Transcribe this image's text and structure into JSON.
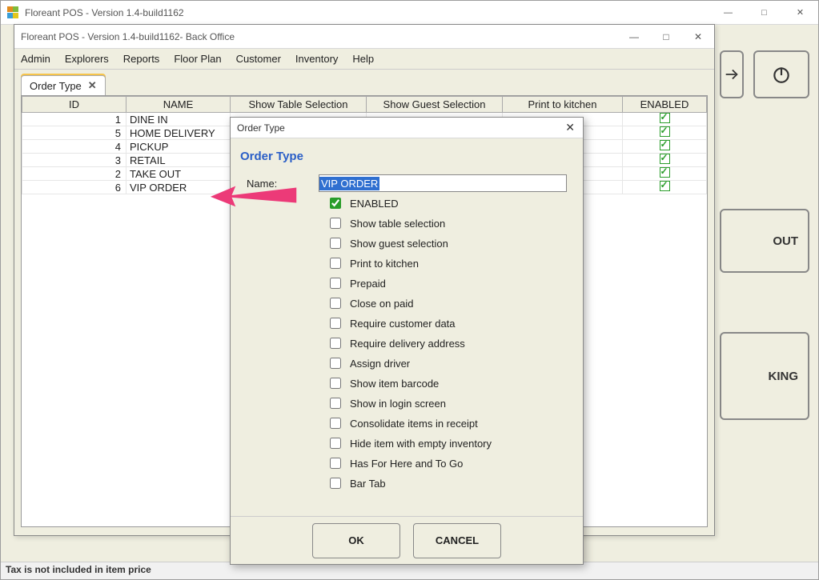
{
  "main": {
    "title": "Floreant POS - Version 1.4-build1162",
    "statusbar": "Tax is not included in item price",
    "side_buttons": {
      "out": "OUT",
      "king": "KING"
    }
  },
  "back_office": {
    "title": "Floreant POS - Version 1.4-build1162- Back Office",
    "menu": [
      "Admin",
      "Explorers",
      "Reports",
      "Floor Plan",
      "Customer",
      "Inventory",
      "Help"
    ],
    "tab": {
      "label": "Order Type"
    },
    "table": {
      "columns": [
        "ID",
        "NAME",
        "Show Table Selection",
        "Show Guest Selection",
        "Print to kitchen",
        "ENABLED"
      ],
      "rows": [
        {
          "id": "1",
          "name": "DINE IN",
          "enabled": true
        },
        {
          "id": "5",
          "name": "HOME DELIVERY",
          "enabled": true
        },
        {
          "id": "4",
          "name": "PICKUP",
          "enabled": true
        },
        {
          "id": "3",
          "name": "RETAIL",
          "enabled": true
        },
        {
          "id": "2",
          "name": "TAKE OUT",
          "enabled": true
        },
        {
          "id": "6",
          "name": "VIP ORDER",
          "enabled": true
        }
      ]
    }
  },
  "dialog": {
    "title": "Order Type",
    "header": "Order Type",
    "name_label": "Name:",
    "name_value": "VIP ORDER",
    "options": [
      {
        "label": "ENABLED",
        "checked": true
      },
      {
        "label": "Show table selection",
        "checked": false
      },
      {
        "label": "Show guest selection",
        "checked": false
      },
      {
        "label": "Print to kitchen",
        "checked": false
      },
      {
        "label": "Prepaid",
        "checked": false
      },
      {
        "label": "Close on paid",
        "checked": false
      },
      {
        "label": "Require customer data",
        "checked": false
      },
      {
        "label": "Require delivery address",
        "checked": false
      },
      {
        "label": "Assign driver",
        "checked": false
      },
      {
        "label": "Show item barcode",
        "checked": false
      },
      {
        "label": "Show in login screen",
        "checked": false
      },
      {
        "label": "Consolidate items in receipt",
        "checked": false
      },
      {
        "label": "Hide item with empty inventory",
        "checked": false
      },
      {
        "label": "Has For Here and To Go",
        "checked": false
      },
      {
        "label": "Bar Tab",
        "checked": false
      }
    ],
    "ok": "OK",
    "cancel": "CANCEL"
  }
}
